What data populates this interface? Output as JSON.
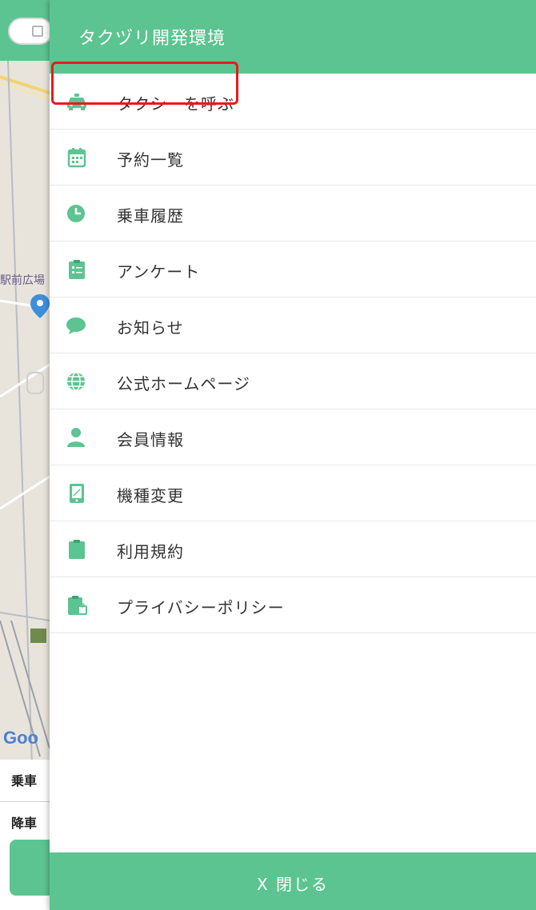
{
  "header": {
    "title": "タクヅリ開発環境"
  },
  "menu": {
    "items": [
      {
        "label": "タクシーを呼ぶ",
        "icon": "taxi-icon"
      },
      {
        "label": "予約一覧",
        "icon": "calendar-icon"
      },
      {
        "label": "乗車履歴",
        "icon": "clock-icon"
      },
      {
        "label": "アンケート",
        "icon": "clipboard-icon"
      },
      {
        "label": "お知らせ",
        "icon": "chat-bubble-icon"
      },
      {
        "label": "公式ホームページ",
        "icon": "globe-icon"
      },
      {
        "label": "会員情報",
        "icon": "user-icon"
      },
      {
        "label": "機種変更",
        "icon": "phone-icon"
      },
      {
        "label": "利用規約",
        "icon": "document-icon"
      },
      {
        "label": "プライバシーポリシー",
        "icon": "privacy-document-icon"
      }
    ]
  },
  "footer": {
    "close_label": "X 閉じる"
  },
  "map": {
    "place_label": "駅前広場",
    "google_label": "Goo",
    "pickup_label": "乗車",
    "dropoff_label": "降車"
  },
  "colors": {
    "accent": "#5cc490",
    "highlight": "#e81b1b"
  }
}
